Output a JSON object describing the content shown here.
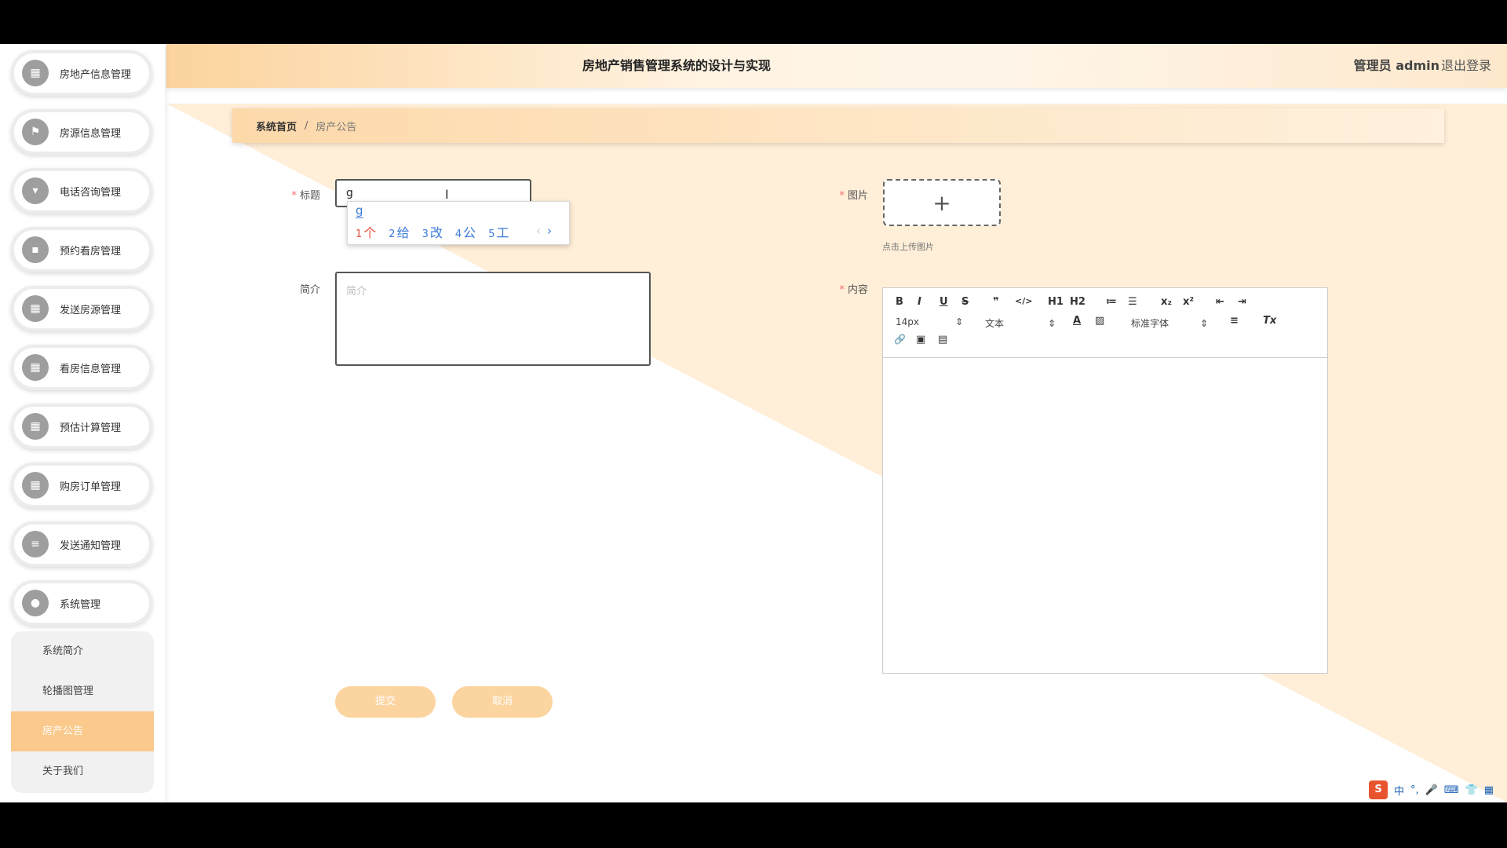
{
  "header": {
    "title": "房地产销售管理系统的设计与实现",
    "user": "管理员 admin",
    "logout": "退出登录"
  },
  "sidebar": {
    "items": [
      {
        "label": "房地产信息管理",
        "icon": "grid-icon",
        "glyph": "▦"
      },
      {
        "label": "房源信息管理",
        "icon": "flag-icon",
        "glyph": "⚑"
      },
      {
        "label": "电话咨询管理",
        "icon": "monitor-icon",
        "glyph": "▾"
      },
      {
        "label": "预约看房管理",
        "icon": "chat-icon",
        "glyph": "▪"
      },
      {
        "label": "发送房源管理",
        "icon": "grid-icon",
        "glyph": "▦"
      },
      {
        "label": "看房信息管理",
        "icon": "grid-icon",
        "glyph": "▦"
      },
      {
        "label": "预估计算管理",
        "icon": "grid-icon",
        "glyph": "▦"
      },
      {
        "label": "购房订单管理",
        "icon": "grid-icon",
        "glyph": "▦"
      },
      {
        "label": "发送通知管理",
        "icon": "list-icon",
        "glyph": "≡"
      },
      {
        "label": "系统管理",
        "icon": "user-icon",
        "glyph": "●"
      }
    ],
    "submenu": [
      "系统简介",
      "轮播图管理",
      "房产公告",
      "关于我们"
    ],
    "active_sub": "房产公告"
  },
  "breadcrumb": {
    "home": "系统首页",
    "sep": "/",
    "current": "房产公告"
  },
  "form": {
    "title_label": "标题",
    "title_value": "g",
    "intro_label": "简介",
    "intro_placeholder": "简介",
    "image_label": "图片",
    "upload_plus": "+",
    "upload_tip": "点击上传图片",
    "content_label": "内容",
    "required_mark": "*",
    "submit": "提交",
    "cancel": "取消"
  },
  "ime": {
    "composition": "g",
    "candidates": [
      {
        "num": "1",
        "text": "个"
      },
      {
        "num": "2",
        "text": "给"
      },
      {
        "num": "3",
        "text": "改"
      },
      {
        "num": "4",
        "text": "公"
      },
      {
        "num": "5",
        "text": "工"
      }
    ],
    "prev": "‹",
    "next": "›"
  },
  "editor": {
    "size": "14px",
    "block": "文本",
    "font": "标准字体",
    "buttons": [
      "B",
      "I",
      "U",
      "S",
      "❞",
      "</>",
      "H1",
      "H2",
      "≔",
      "☰",
      "x₂",
      "x²",
      "⇤",
      "⇥",
      "A",
      "▨",
      "≡",
      "Tx",
      "🔗",
      "▣",
      "▤"
    ]
  },
  "tray": [
    "中",
    "°,",
    "🎤",
    "⌨",
    "👕",
    "▦"
  ]
}
